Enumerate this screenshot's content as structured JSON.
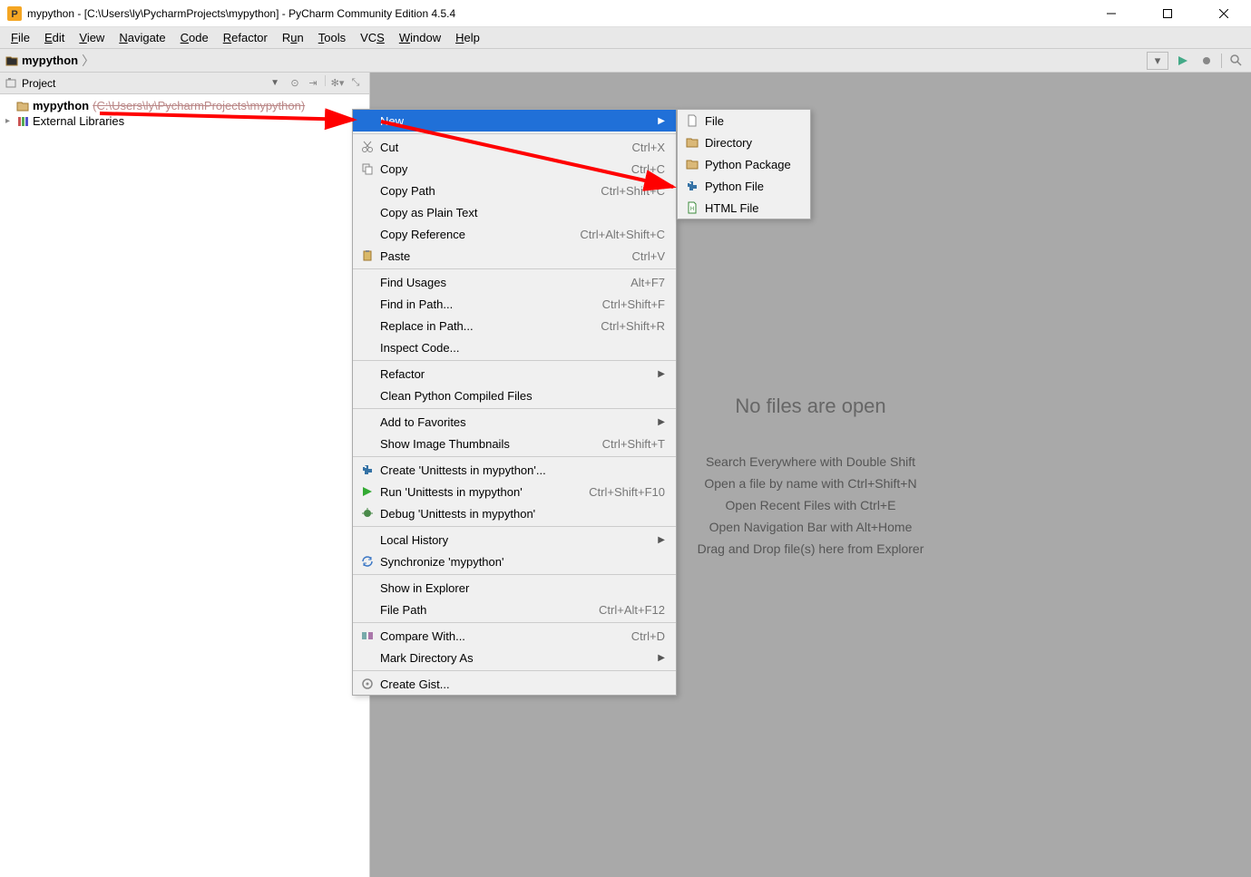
{
  "titlebar": {
    "text": "mypython - [C:\\Users\\ly\\PycharmProjects\\mypython] - PyCharm Community Edition 4.5.4"
  },
  "menubar": [
    "File",
    "Edit",
    "View",
    "Navigate",
    "Code",
    "Refactor",
    "Run",
    "Tools",
    "VCS",
    "Window",
    "Help"
  ],
  "breadcrumb": {
    "project": "mypython"
  },
  "sidebar": {
    "title": "Project",
    "root_name": "mypython",
    "root_path": "C:\\Users\\ly\\PycharmProjects\\mypython",
    "external": "External Libraries"
  },
  "editor": {
    "title": "No files are open",
    "hints": [
      "Search Everywhere with Double Shift",
      "Open a file by name with Ctrl+Shift+N",
      "Open Recent Files with Ctrl+E",
      "Open Navigation Bar with Alt+Home",
      "Drag and Drop file(s) here from Explorer"
    ]
  },
  "context_menu": [
    {
      "label": "New",
      "selected": true,
      "submenu_arrow": true
    },
    {
      "sep": true
    },
    {
      "label": "Cut",
      "shortcut": "Ctrl+X",
      "icon": "cut"
    },
    {
      "label": "Copy",
      "shortcut": "Ctrl+C",
      "icon": "copy"
    },
    {
      "label": "Copy Path",
      "shortcut": "Ctrl+Shift+C"
    },
    {
      "label": "Copy as Plain Text"
    },
    {
      "label": "Copy Reference",
      "shortcut": "Ctrl+Alt+Shift+C"
    },
    {
      "label": "Paste",
      "shortcut": "Ctrl+V",
      "icon": "paste"
    },
    {
      "sep": true
    },
    {
      "label": "Find Usages",
      "shortcut": "Alt+F7"
    },
    {
      "label": "Find in Path...",
      "shortcut": "Ctrl+Shift+F"
    },
    {
      "label": "Replace in Path...",
      "shortcut": "Ctrl+Shift+R"
    },
    {
      "label": "Inspect Code..."
    },
    {
      "sep": true
    },
    {
      "label": "Refactor",
      "submenu_arrow": true
    },
    {
      "label": "Clean Python Compiled Files"
    },
    {
      "sep": true
    },
    {
      "label": "Add to Favorites",
      "submenu_arrow": true
    },
    {
      "label": "Show Image Thumbnails",
      "shortcut": "Ctrl+Shift+T"
    },
    {
      "sep": true
    },
    {
      "label": "Create 'Unittests in mypython'...",
      "icon": "python"
    },
    {
      "label": "Run 'Unittests in mypython'",
      "shortcut": "Ctrl+Shift+F10",
      "icon": "run"
    },
    {
      "label": "Debug 'Unittests in mypython'",
      "icon": "debug"
    },
    {
      "sep": true
    },
    {
      "label": "Local History",
      "submenu_arrow": true
    },
    {
      "label": "Synchronize 'mypython'",
      "icon": "sync"
    },
    {
      "sep": true
    },
    {
      "label": "Show in Explorer"
    },
    {
      "label": "File Path",
      "shortcut": "Ctrl+Alt+F12"
    },
    {
      "sep": true
    },
    {
      "label": "Compare With...",
      "shortcut": "Ctrl+D",
      "icon": "compare"
    },
    {
      "label": "Mark Directory As",
      "submenu_arrow": true
    },
    {
      "sep": true
    },
    {
      "label": "Create Gist...",
      "icon": "gist"
    }
  ],
  "submenu": [
    {
      "label": "File",
      "icon": "file"
    },
    {
      "label": "Directory",
      "icon": "folder"
    },
    {
      "label": "Python Package",
      "icon": "folder"
    },
    {
      "label": "Python File",
      "icon": "python"
    },
    {
      "label": "HTML File",
      "icon": "html"
    }
  ]
}
